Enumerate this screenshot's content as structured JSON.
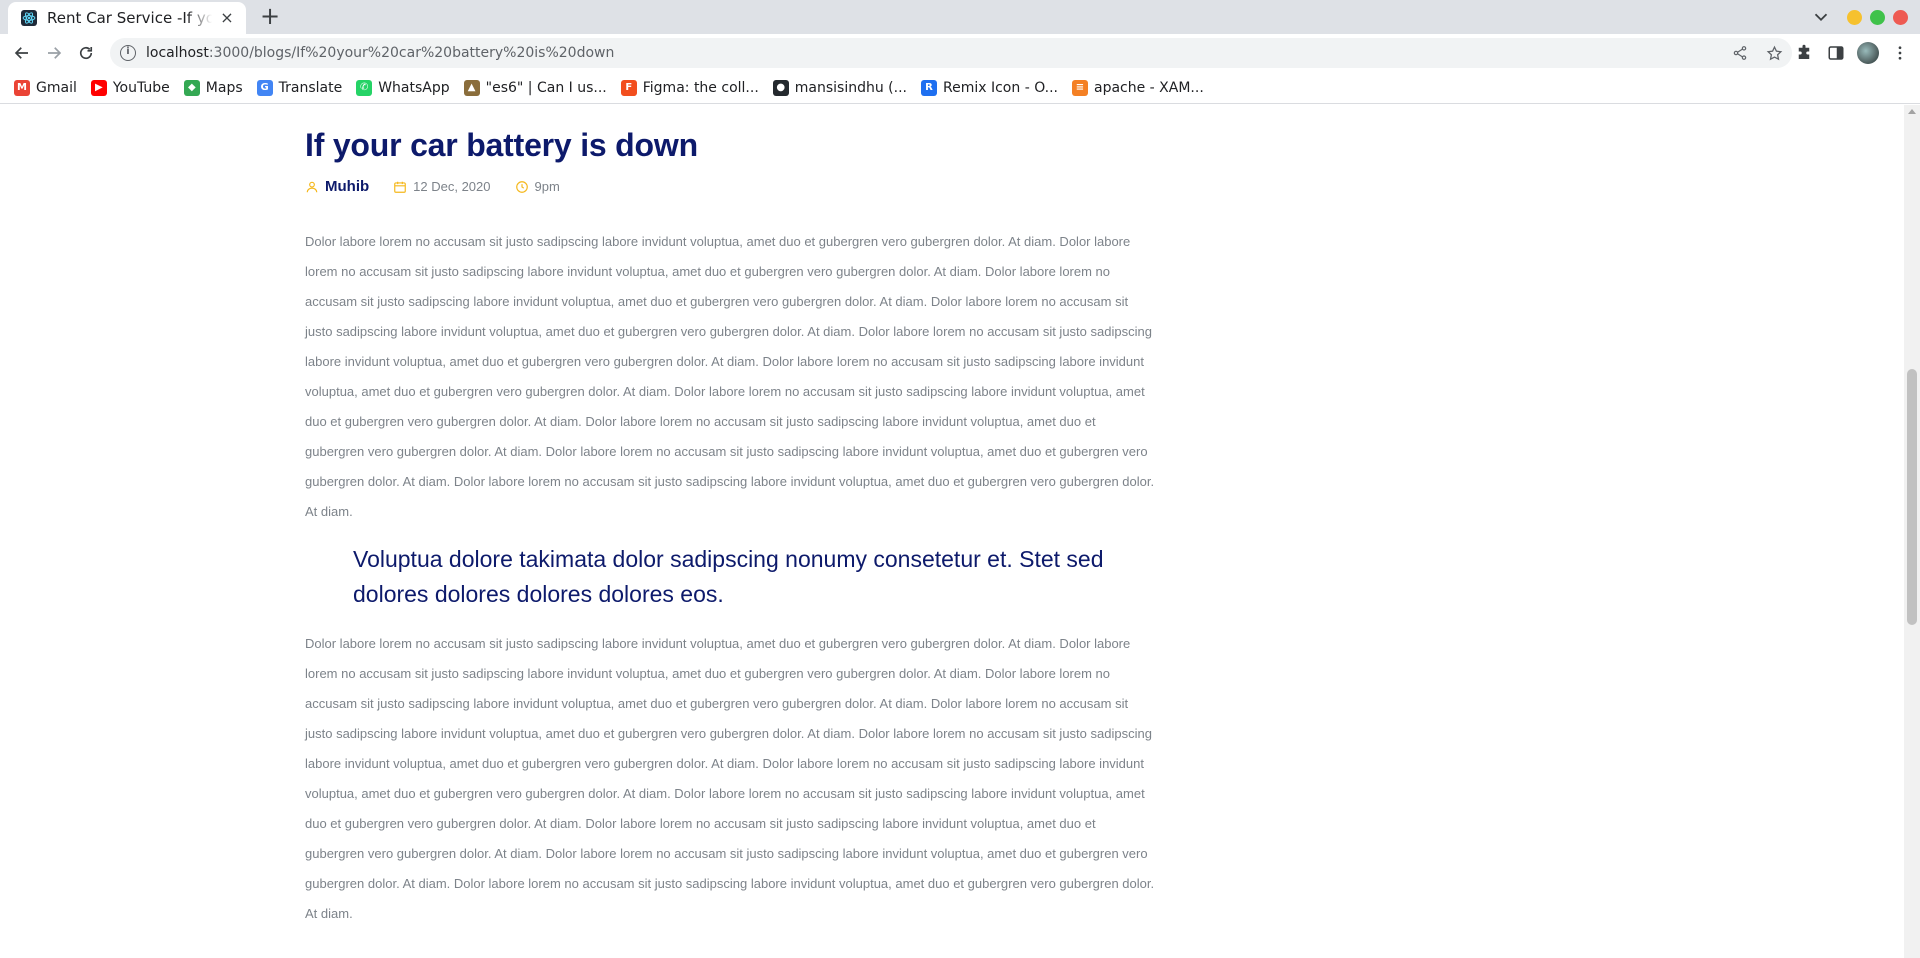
{
  "browser": {
    "tab": {
      "title": "Rent Car Service -If your car battery is down",
      "close": "×"
    },
    "new_tab": "+",
    "address": {
      "host": "localhost",
      "rest": ":3000/blogs/If%20your%20car%20battery%20is%20down"
    },
    "bookmarks": [
      {
        "label": "Gmail",
        "icon": "gmail-icon",
        "color": "#ea4335"
      },
      {
        "label": "YouTube",
        "icon": "youtube-icon",
        "color": "#ff0000"
      },
      {
        "label": "Maps",
        "icon": "maps-icon",
        "color": "#34a853"
      },
      {
        "label": "Translate",
        "icon": "translate-icon",
        "color": "#4285f4"
      },
      {
        "label": "WhatsApp",
        "icon": "whatsapp-icon",
        "color": "#25d366"
      },
      {
        "label": "\"es6\" | Can I us...",
        "icon": "caniuse-icon",
        "color": "#8a6d3b"
      },
      {
        "label": "Figma: the coll...",
        "icon": "figma-icon",
        "color": "#f24e1e"
      },
      {
        "label": "mansisindhu (...",
        "icon": "github-icon",
        "color": "#24292e"
      },
      {
        "label": "Remix Icon - O...",
        "icon": "remixicon-icon",
        "color": "#1e6ff0"
      },
      {
        "label": "apache - XAM...",
        "icon": "stackoverflow-icon",
        "color": "#f48024"
      }
    ]
  },
  "post": {
    "title": "If your car battery is down",
    "author": "Muhib",
    "date": "12 Dec, 2020",
    "time": "9pm",
    "paragraph_1": "Dolor labore lorem no accusam sit justo sadipscing labore invidunt voluptua, amet duo et gubergren vero gubergren dolor. At diam. Dolor labore lorem no accusam sit justo sadipscing labore invidunt voluptua, amet duo et gubergren vero gubergren dolor. At diam. Dolor labore lorem no accusam sit justo sadipscing labore invidunt voluptua, amet duo et gubergren vero gubergren dolor. At diam. Dolor labore lorem no accusam sit justo sadipscing labore invidunt voluptua, amet duo et gubergren vero gubergren dolor. At diam. Dolor labore lorem no accusam sit justo sadipscing labore invidunt voluptua, amet duo et gubergren vero gubergren dolor. At diam. Dolor labore lorem no accusam sit justo sadipscing labore invidunt voluptua, amet duo et gubergren vero gubergren dolor. At diam. Dolor labore lorem no accusam sit justo sadipscing labore invidunt voluptua, amet duo et gubergren vero gubergren dolor. At diam. Dolor labore lorem no accusam sit justo sadipscing labore invidunt voluptua, amet duo et gubergren vero gubergren dolor. At diam. Dolor labore lorem no accusam sit justo sadipscing labore invidunt voluptua, amet duo et gubergren vero gubergren dolor. At diam. Dolor labore lorem no accusam sit justo sadipscing labore invidunt voluptua, amet duo et gubergren vero gubergren dolor. At diam.",
    "quote": "Voluptua dolore takimata dolor sadipscing nonumy consetetur et. Stet sed dolores dolores dolores dolores eos.",
    "paragraph_2": "Dolor labore lorem no accusam sit justo sadipscing labore invidunt voluptua, amet duo et gubergren vero gubergren dolor. At diam. Dolor labore lorem no accusam sit justo sadipscing labore invidunt voluptua, amet duo et gubergren vero gubergren dolor. At diam. Dolor labore lorem no accusam sit justo sadipscing labore invidunt voluptua, amet duo et gubergren vero gubergren dolor. At diam. Dolor labore lorem no accusam sit justo sadipscing labore invidunt voluptua, amet duo et gubergren vero gubergren dolor. At diam. Dolor labore lorem no accusam sit justo sadipscing labore invidunt voluptua, amet duo et gubergren vero gubergren dolor. At diam. Dolor labore lorem no accusam sit justo sadipscing labore invidunt voluptua, amet duo et gubergren vero gubergren dolor. At diam. Dolor labore lorem no accusam sit justo sadipscing labore invidunt voluptua, amet duo et gubergren vero gubergren dolor. At diam. Dolor labore lorem no accusam sit justo sadipscing labore invidunt voluptua, amet duo et gubergren vero gubergren dolor. At diam. Dolor labore lorem no accusam sit justo sadipscing labore invidunt voluptua, amet duo et gubergren vero gubergren dolor. At diam. Dolor labore lorem no accusam sit justo sadipscing labore invidunt voluptua, amet duo et gubergren vero gubergren dolor. At diam."
  },
  "colors": {
    "heading": "#0d1a6b",
    "body_text": "#7d838a",
    "meta_icon": "#f5b81c"
  }
}
